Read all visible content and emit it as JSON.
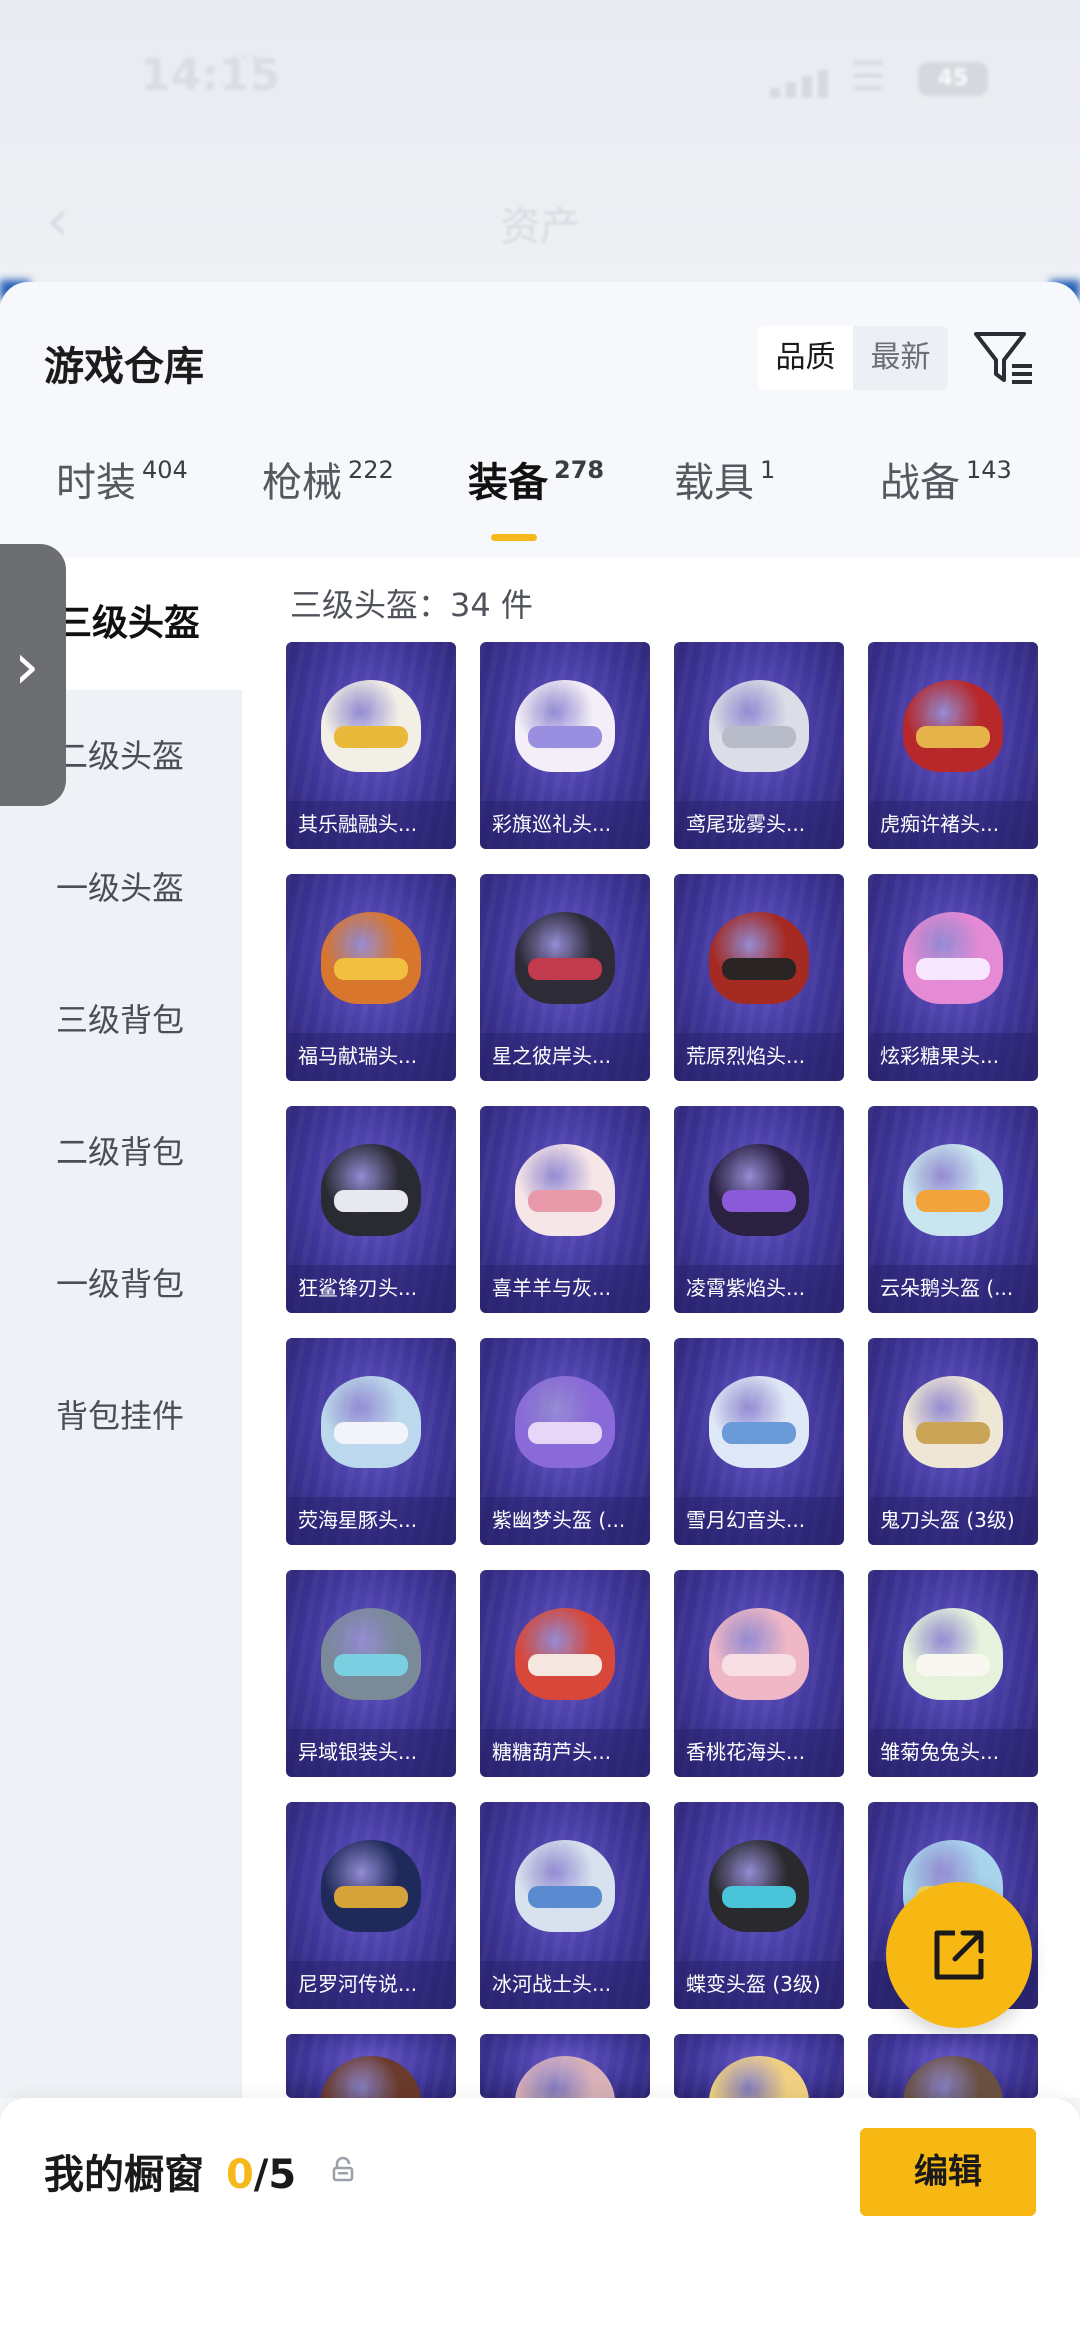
{
  "status_bar": {
    "time": "14:15",
    "carrier": "...",
    "carrier2": "",
    "battery": "45"
  },
  "header": {
    "back_icon": "chevron-left-icon",
    "title": "资产"
  },
  "panel": {
    "title": "游戏仓库",
    "sort": {
      "options": [
        "品质",
        "最新"
      ],
      "selected": "品质"
    },
    "filter_icon": "filter-icon"
  },
  "tabs": [
    {
      "label": "时装",
      "count": "404"
    },
    {
      "label": "枪械",
      "count": "222"
    },
    {
      "label": "装备",
      "count": "278",
      "active": true
    },
    {
      "label": "载具",
      "count": "1"
    },
    {
      "label": "战备",
      "count": "143"
    }
  ],
  "categories": [
    "三级头盔",
    "二级头盔",
    "一级头盔",
    "三级背包",
    "二级背包",
    "一级背包",
    "背包挂件"
  ],
  "active_category": "三级头盔",
  "item_count": "三级头盔：34 件",
  "items": [
    {
      "name": "其乐融融头...",
      "color": "#f2efe6",
      "accent": "#e8b93a"
    },
    {
      "name": "彩旗巡礼头...",
      "color": "#f3eef7",
      "accent": "#9a8ee0"
    },
    {
      "name": "鸢尾珑雾头...",
      "color": "#dcdde6",
      "accent": "#b8bcc8"
    },
    {
      "name": "虎痴许褚头...",
      "color": "#b8282a",
      "accent": "#e6b24a"
    },
    {
      "name": "福马献瑞头...",
      "color": "#d9762e",
      "accent": "#f1c040"
    },
    {
      "name": "星之彼岸头...",
      "color": "#2d2b36",
      "accent": "#c23a4e"
    },
    {
      "name": "荒原烈焰头...",
      "color": "#a52a22",
      "accent": "#2a2424"
    },
    {
      "name": "炫彩糖果头...",
      "color": "#e58ad4",
      "accent": "#f6e7ff"
    },
    {
      "name": "狂鲨锋刃头...",
      "color": "#2a2a33",
      "accent": "#e8e8ef"
    },
    {
      "name": "喜羊羊与灰...",
      "color": "#f6e6e8",
      "accent": "#e89aaa"
    },
    {
      "name": "凌霄紫焰头...",
      "color": "#2a2040",
      "accent": "#8a5ad8"
    },
    {
      "name": "云朵鹅头盔 (...",
      "color": "#c9e5ef",
      "accent": "#f2a43a"
    },
    {
      "name": "荧海星豚头...",
      "color": "#bcd8ec",
      "accent": "#f2f4fa"
    },
    {
      "name": "紫幽梦头盔 (...",
      "color": "#8a6ad8",
      "accent": "#e8d6f8"
    },
    {
      "name": "雪月幻音头...",
      "color": "#dfe8f6",
      "accent": "#6a9ad8"
    },
    {
      "name": "鬼刀头盔 (3级)",
      "color": "#efe7d6",
      "accent": "#caa558"
    },
    {
      "name": "异域银装头...",
      "color": "#7a8a98",
      "accent": "#7ad0e0"
    },
    {
      "name": "糖糖葫芦头...",
      "color": "#d8483a",
      "accent": "#f6e6e0"
    },
    {
      "name": "香桃花海头...",
      "color": "#f0b8c6",
      "accent": "#f8dfe6"
    },
    {
      "name": "雏菊兔兔头...",
      "color": "#e6f2dc",
      "accent": "#f8f8f0"
    },
    {
      "name": "尼罗河传说...",
      "color": "#1e2a5a",
      "accent": "#d6a23a"
    },
    {
      "name": "冰河战士头...",
      "color": "#d8e2ee",
      "accent": "#5a8ad0"
    },
    {
      "name": "蝶变头盔 (3级)",
      "color": "#2a2a2e",
      "accent": "#4ac4d8"
    },
    {
      "name": "",
      "color": "#a8d4ec",
      "accent": "#f0d060"
    },
    {
      "name": "",
      "color": "#6a3a2a",
      "accent": "#c8a070"
    },
    {
      "name": "",
      "color": "#d8b0b8",
      "accent": "#8a5a6a"
    },
    {
      "name": "",
      "color": "#f0d080",
      "accent": "#f8e8b0"
    },
    {
      "name": "",
      "color": "#6a5040",
      "accent": "#c8b0a0"
    }
  ],
  "share_button_icon": "share-icon",
  "showcase": {
    "label": "我的橱窗",
    "current": "0",
    "total": "/5",
    "lock_icon": "lock-icon",
    "edit_label": "编辑"
  }
}
